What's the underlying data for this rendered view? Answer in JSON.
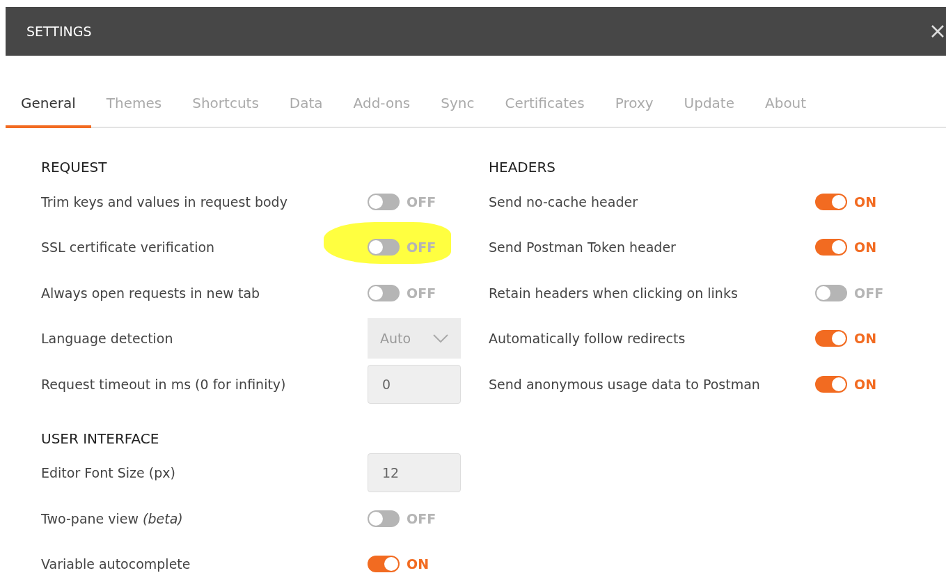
{
  "window": {
    "title": "SETTINGS"
  },
  "tabs": [
    {
      "label": "General",
      "selected": true
    },
    {
      "label": "Themes",
      "selected": false
    },
    {
      "label": "Shortcuts",
      "selected": false
    },
    {
      "label": "Data",
      "selected": false
    },
    {
      "label": "Add-ons",
      "selected": false
    },
    {
      "label": "Sync",
      "selected": false
    },
    {
      "label": "Certificates",
      "selected": false
    },
    {
      "label": "Proxy",
      "selected": false
    },
    {
      "label": "Update",
      "selected": false
    },
    {
      "label": "About",
      "selected": false
    }
  ],
  "columns": [
    {
      "sections": [
        {
          "title": "REQUEST",
          "rows": [
            {
              "kind": "toggle",
              "label": "Trim keys and values in request body",
              "on": false,
              "state_label": "OFF",
              "highlighted": false
            },
            {
              "kind": "toggle",
              "label": "SSL certificate verification",
              "on": false,
              "state_label": "OFF",
              "highlighted": true
            },
            {
              "kind": "toggle",
              "label": "Always open requests in new tab",
              "on": false,
              "state_label": "OFF",
              "highlighted": false
            },
            {
              "kind": "select",
              "label": "Language detection",
              "value": "Auto",
              "disabled": true
            },
            {
              "kind": "number",
              "label": "Request timeout in ms (0 for infinity)",
              "value": "0"
            }
          ]
        },
        {
          "title": "USER INTERFACE",
          "rows": [
            {
              "kind": "number",
              "label": "Editor Font Size (px)",
              "value": "12"
            },
            {
              "kind": "toggle",
              "label": "Two-pane view *(beta)*",
              "on": false,
              "state_label": "OFF",
              "highlighted": false
            },
            {
              "kind": "toggle",
              "label": "Variable autocomplete",
              "on": true,
              "state_label": "ON",
              "highlighted": false
            }
          ]
        }
      ]
    },
    {
      "sections": [
        {
          "title": "HEADERS",
          "rows": [
            {
              "kind": "toggle",
              "label": "Send no-cache header",
              "on": true,
              "state_label": "ON",
              "highlighted": false
            },
            {
              "kind": "toggle",
              "label": "Send Postman Token header",
              "on": true,
              "state_label": "ON",
              "highlighted": false
            },
            {
              "kind": "toggle",
              "label": "Retain headers when clicking on links",
              "on": false,
              "state_label": "OFF",
              "highlighted": false
            },
            {
              "kind": "toggle",
              "label": "Automatically follow redirects",
              "on": true,
              "state_label": "ON",
              "highlighted": false
            },
            {
              "kind": "toggle",
              "label": "Send anonymous usage data to Postman",
              "on": true,
              "state_label": "ON",
              "highlighted": false
            }
          ]
        }
      ]
    }
  ]
}
